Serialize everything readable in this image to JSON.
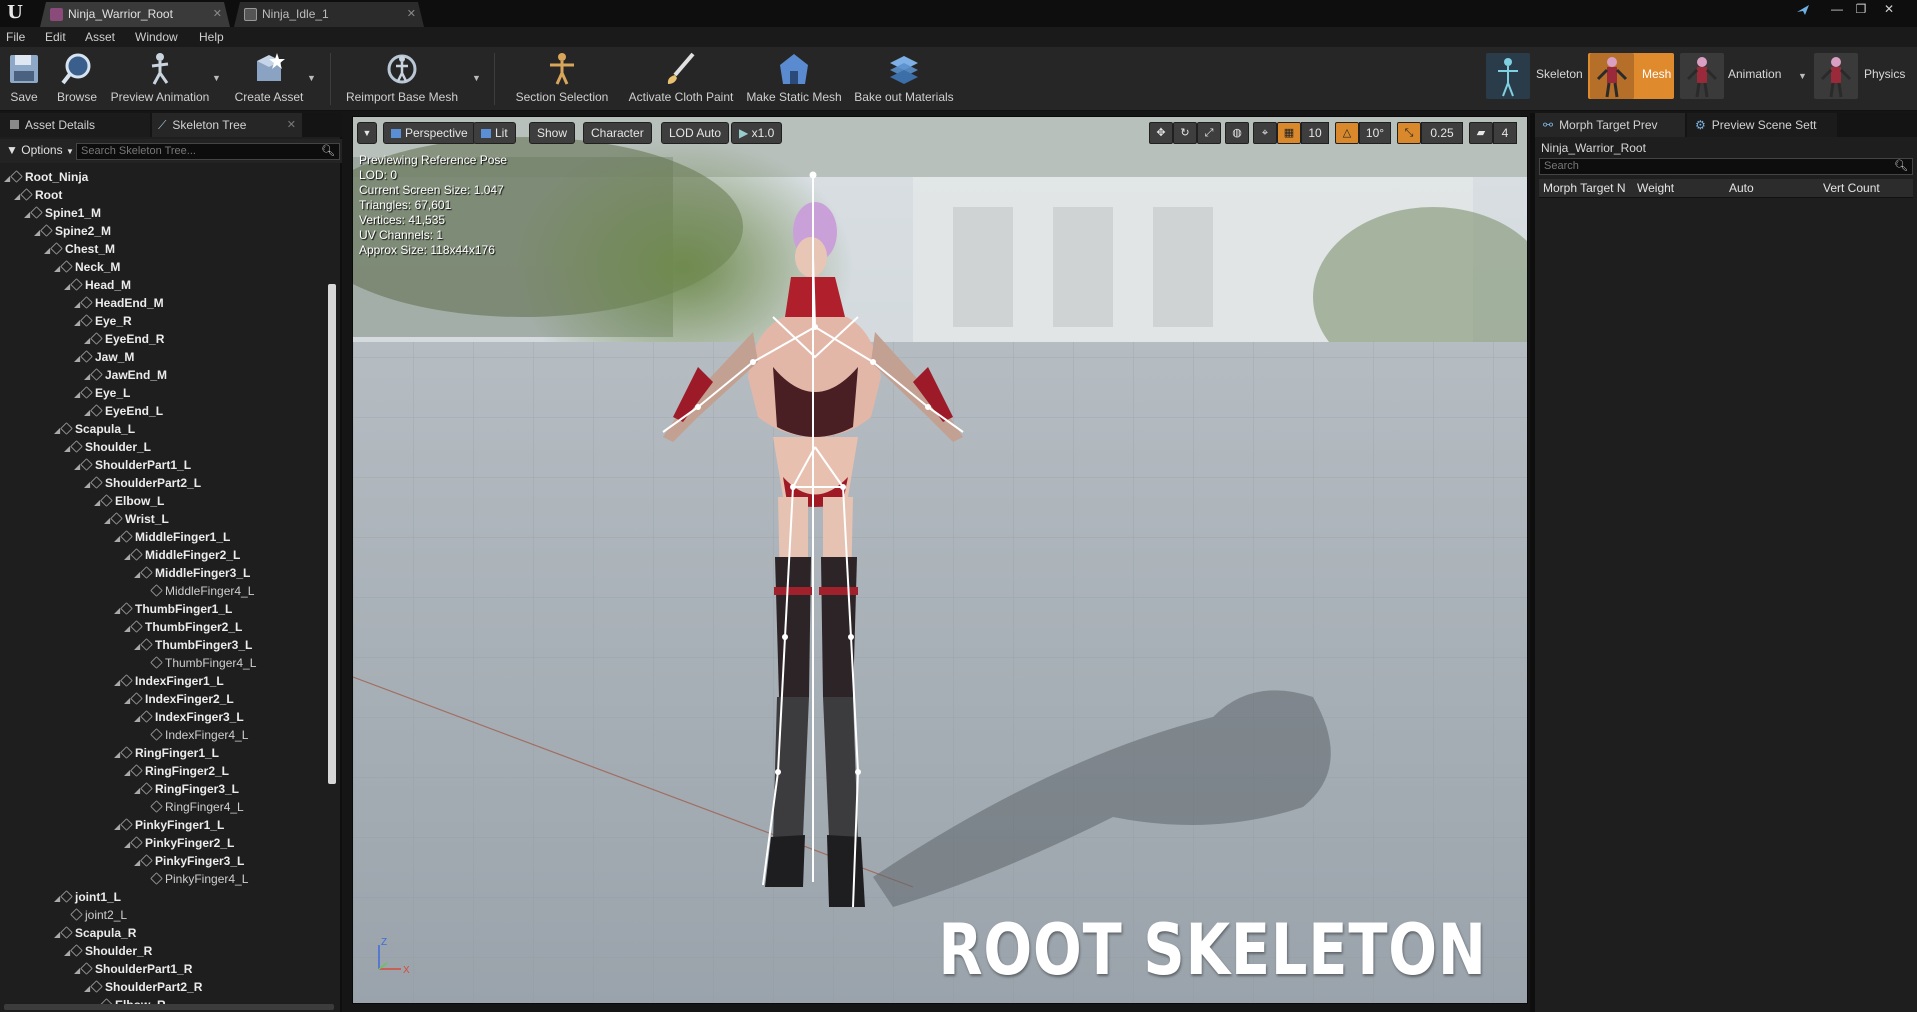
{
  "titlebar": {
    "tabs": [
      {
        "label": "Ninja_Warrior_Root",
        "active": true,
        "icon": "skeletal-mesh-icon",
        "close": "✕"
      },
      {
        "label": "Ninja_Idle_1",
        "active": false,
        "icon": "animation-sequence-icon",
        "close": "✕"
      }
    ],
    "window_buttons": [
      "—",
      "❐",
      "✕"
    ]
  },
  "menubar": [
    "File",
    "Edit",
    "Asset",
    "Window",
    "Help"
  ],
  "toolbar": {
    "buttons": [
      {
        "label": "Save",
        "icon": "save-icon"
      },
      {
        "label": "Browse",
        "icon": "browse-icon"
      },
      {
        "label": "Preview Animation",
        "icon": "preview-animation-icon"
      },
      {
        "label": "Create Asset",
        "icon": "create-asset-icon"
      },
      {
        "label": "Reimport Base Mesh",
        "icon": "reimport-icon"
      },
      {
        "label": "Section Selection",
        "icon": "section-selection-icon"
      },
      {
        "label": "Activate Cloth Paint",
        "icon": "cloth-paint-icon"
      },
      {
        "label": "Make Static Mesh",
        "icon": "static-mesh-icon"
      },
      {
        "label": "Bake out Materials",
        "icon": "bake-materials-icon"
      }
    ],
    "modes": [
      {
        "label": "Skeleton",
        "active": false
      },
      {
        "label": "Mesh",
        "active": true
      },
      {
        "label": "Animation",
        "active": false
      },
      {
        "label": "Physics",
        "active": false
      }
    ],
    "accent": "#e08a2e"
  },
  "left_panel": {
    "tabs": [
      "Asset Details",
      "Skeleton Tree"
    ],
    "options_label": "Options",
    "search_placeholder": "Search Skeleton Tree...",
    "tree": [
      {
        "name": "Root_Ninja",
        "depth": 0
      },
      {
        "name": "Root",
        "depth": 1
      },
      {
        "name": "Spine1_M",
        "depth": 2
      },
      {
        "name": "Spine2_M",
        "depth": 3
      },
      {
        "name": "Chest_M",
        "depth": 4
      },
      {
        "name": "Neck_M",
        "depth": 5
      },
      {
        "name": "Head_M",
        "depth": 6
      },
      {
        "name": "HeadEnd_M",
        "depth": 7
      },
      {
        "name": "Eye_R",
        "depth": 7
      },
      {
        "name": "EyeEnd_R",
        "depth": 8
      },
      {
        "name": "Jaw_M",
        "depth": 7
      },
      {
        "name": "JawEnd_M",
        "depth": 8
      },
      {
        "name": "Eye_L",
        "depth": 7
      },
      {
        "name": "EyeEnd_L",
        "depth": 8
      },
      {
        "name": "Scapula_L",
        "depth": 5
      },
      {
        "name": "Shoulder_L",
        "depth": 6
      },
      {
        "name": "ShoulderPart1_L",
        "depth": 7
      },
      {
        "name": "ShoulderPart2_L",
        "depth": 8
      },
      {
        "name": "Elbow_L",
        "depth": 9
      },
      {
        "name": "Wrist_L",
        "depth": 10
      },
      {
        "name": "MiddleFinger1_L",
        "depth": 11
      },
      {
        "name": "MiddleFinger2_L",
        "depth": 12
      },
      {
        "name": "MiddleFinger3_L",
        "depth": 13
      },
      {
        "name": "MiddleFinger4_L",
        "depth": 14,
        "leaf": true
      },
      {
        "name": "ThumbFinger1_L",
        "depth": 11
      },
      {
        "name": "ThumbFinger2_L",
        "depth": 12
      },
      {
        "name": "ThumbFinger3_L",
        "depth": 13
      },
      {
        "name": "ThumbFinger4_L",
        "depth": 14,
        "leaf": true
      },
      {
        "name": "IndexFinger1_L",
        "depth": 11
      },
      {
        "name": "IndexFinger2_L",
        "depth": 12
      },
      {
        "name": "IndexFinger3_L",
        "depth": 13
      },
      {
        "name": "IndexFinger4_L",
        "depth": 14,
        "leaf": true
      },
      {
        "name": "RingFinger1_L",
        "depth": 11
      },
      {
        "name": "RingFinger2_L",
        "depth": 12
      },
      {
        "name": "RingFinger3_L",
        "depth": 13
      },
      {
        "name": "RingFinger4_L",
        "depth": 14,
        "leaf": true
      },
      {
        "name": "PinkyFinger1_L",
        "depth": 11
      },
      {
        "name": "PinkyFinger2_L",
        "depth": 12
      },
      {
        "name": "PinkyFinger3_L",
        "depth": 13
      },
      {
        "name": "PinkyFinger4_L",
        "depth": 14,
        "leaf": true
      },
      {
        "name": "joint1_L",
        "depth": 5
      },
      {
        "name": "joint2_L",
        "depth": 6,
        "leaf": true
      },
      {
        "name": "Scapula_R",
        "depth": 5
      },
      {
        "name": "Shoulder_R",
        "depth": 6
      },
      {
        "name": "ShoulderPart1_R",
        "depth": 7
      },
      {
        "name": "ShoulderPart2_R",
        "depth": 8
      },
      {
        "name": "Elbow_R",
        "depth": 9
      }
    ]
  },
  "viewport": {
    "toolbar": {
      "view_mode": "Perspective",
      "lighting": "Lit",
      "show": "Show",
      "character": "Character",
      "lod": "LOD Auto",
      "speed": "x1.0",
      "grid_snap": "10",
      "rotation_snap": "10°",
      "scale_snap": "0.25",
      "camera_speed": "4"
    },
    "stats": [
      "Previewing Reference Pose",
      "LOD: 0",
      "Current Screen Size: 1.047",
      "Triangles: 67,601",
      "Vertices: 41,535",
      "UV Channels: 1",
      "Approx Size: 118x44x176"
    ],
    "caption": "ROOT SKELETON",
    "axis": {
      "z": "Z",
      "x": "X"
    }
  },
  "right_panel": {
    "tabs": [
      "Morph Target Prev",
      "Preview Scene Sett"
    ],
    "asset_name": "Ninja_Warrior_Root",
    "search_placeholder": "Search",
    "columns": [
      "Morph Target N",
      "Weight",
      "Auto",
      "Vert Count"
    ]
  }
}
